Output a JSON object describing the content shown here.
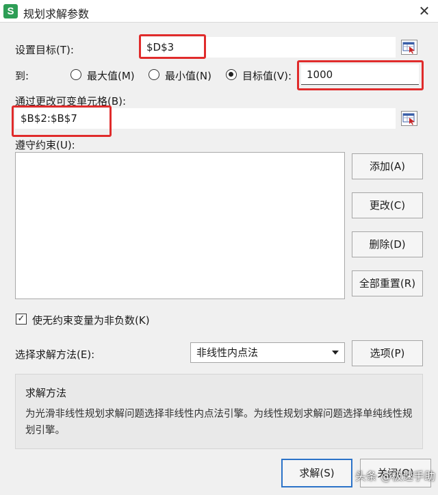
{
  "window": {
    "title": "规划求解参数",
    "icon_letter": "S",
    "close_glyph": "✕"
  },
  "objective": {
    "label": "设置目标(T):",
    "value": "$D$3"
  },
  "to": {
    "label": "到:",
    "options": [
      {
        "label": "最大值(M)",
        "checked": false
      },
      {
        "label": "最小值(N)",
        "checked": false
      },
      {
        "label": "目标值(V):",
        "checked": true
      }
    ],
    "target_value": "1000"
  },
  "changing_cells": {
    "label": "通过更改可变单元格(B):",
    "value": "$B$2:$B$7"
  },
  "constraints": {
    "label": "遵守约束(U):",
    "items": []
  },
  "buttons": {
    "add": "添加(A)",
    "change": "更改(C)",
    "delete": "删除(D)",
    "reset_all": "全部重置(R)",
    "options": "选项(P)",
    "solve": "求解(S)",
    "close": "关闭(O)"
  },
  "nonnegative": {
    "label": "使无约束变量为非负数(K)",
    "checked": true
  },
  "method": {
    "label": "选择求解方法(E):",
    "selected": "非线性内点法"
  },
  "info": {
    "title": "求解方法",
    "text": "为光滑非线性规划求解问题选择非线性内点法引擎。为线性规划求解问题选择单纯线性规划引擎。"
  },
  "watermark": "头条 @极速手助",
  "colors": {
    "highlight": "#e02b2b",
    "app_icon": "#2e9e56",
    "default_button_border": "#2a72c8"
  }
}
